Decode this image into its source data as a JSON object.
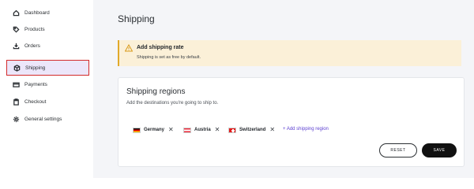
{
  "sidebar": {
    "items": [
      {
        "label": "Dashboard",
        "icon": "home-icon"
      },
      {
        "label": "Products",
        "icon": "tag-icon"
      },
      {
        "label": "Orders",
        "icon": "download-tray-icon"
      },
      {
        "label": "Shipping",
        "icon": "box-icon",
        "active": true
      },
      {
        "label": "Payments",
        "icon": "credit-card-icon"
      },
      {
        "label": "Checkout",
        "icon": "clipboard-icon"
      },
      {
        "label": "General settings",
        "icon": "gear-icon"
      }
    ]
  },
  "page": {
    "title": "Shipping"
  },
  "alert": {
    "title": "Add shipping rate",
    "message": "Shipping is set as free by default.",
    "color": "#fbf0d8"
  },
  "regions": {
    "title": "Shipping regions",
    "subtitle": "Add the destinations you're going to ship to.",
    "countries": [
      "Germany",
      "Austria",
      "Switzerland"
    ],
    "add_label": "+ Add shipping region",
    "reset_label": "RESET",
    "save_label": "SAVE"
  },
  "colors": {
    "accent": "#5c3fd1",
    "active_bg": "#ece6fa",
    "highlight": "#d32a2a"
  }
}
